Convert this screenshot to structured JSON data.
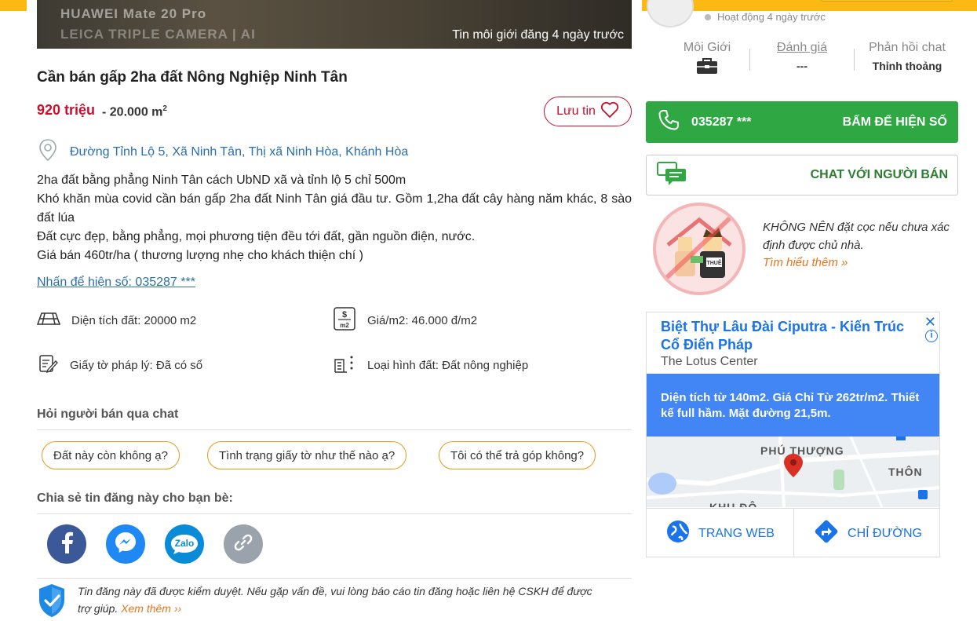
{
  "listing": {
    "photo_watermark_1": "HUAWEI Mate 20 Pro",
    "photo_watermark_2": "LEICA TRIPLE CAMERA | AI",
    "photo_caption": "Tin môi giới đăng 4 ngày trước",
    "title": "Cần bán gấp 2ha đất Nông Nghiệp Ninh Tân",
    "price": "920 triệu",
    "area_prefix": "- 20.000 m",
    "area_sup": "2",
    "save_label": "Lưu tin",
    "address": "Đường Tỉnh Lộ 5, Xã Ninh Tân, Thị xã Ninh Hòa, Khánh Hòa",
    "description": [
      "2ha đất bằng phẳng Ninh Tân cách UbND xã và tỉnh lộ 5 chỉ 500m",
      "Khó khăn mùa covid cần bán gấp 2ha đất Ninh Tân giá đầu tư. Gồm 1,2ha đất cây hàng năm khác, 8 sào đất lúa",
      "Đất cực đẹp, bằng phẳng, mọi phương tiện đều tới đất, gần nguồn điện, nước.",
      "Giá bán 460tr/ha ( thương lượng nhẹ cho khách thiện chí )"
    ],
    "show_phone_link": "Nhấn để hiện số: 035287 ***",
    "specs": {
      "area": "Diện tích đất: 20000 m2",
      "price_per_m2": "Giá/m2: 46.000 đ/m2",
      "legal": "Giấy tờ pháp lý: Đã có sổ",
      "land_type": "Loại hình đất: Đất nông nghiệp"
    }
  },
  "chat_section": {
    "title": "Hỏi người bán qua chat",
    "questions": [
      "Đất này còn không ạ?",
      "Tình trạng giấy tờ như thế nào ạ?",
      "Tôi có thể trả góp không?"
    ]
  },
  "share_section": {
    "title": "Chia sẻ tin đăng này cho bạn bè:",
    "zalo_label": "Zalo"
  },
  "notice": {
    "text": "Tin đăng này đã được kiểm duyệt. Nếu gặp vấn đề, vui lòng báo cáo tin đăng hoặc liên hệ CSKH để được trợ giúp.",
    "more": "Xem thêm ››"
  },
  "seller": {
    "activity": "Hoạt động 4 ngày trước",
    "stats": [
      {
        "label": "Môi Giới",
        "value": ""
      },
      {
        "label": "Đánh giá",
        "value": "---"
      },
      {
        "label": "Phản hồi chat",
        "value": "Thỉnh thoảng"
      }
    ],
    "phone": "035287 ***",
    "phone_cta": "BẤM ĐỂ HIỆN SỐ",
    "chat_cta": "CHAT VỚI NGƯỜI BÁN"
  },
  "warning": {
    "text": "KHÔNG NÊN đặt cọc nếu chưa xác định được chủ nhà.",
    "link": "Tìm hiểu thêm »",
    "sign_text": "THUÊ"
  },
  "ad": {
    "title": "Biệt Thự Lâu Đài Ciputra - Kiến Trúc Cổ Điển Pháp",
    "subtitle": "The Lotus Center",
    "body": "Diện tích từ 140m2. Giá Chỉ Từ 262tr/m2. Thiết kế full hầm. Mặt đường 21,5m.",
    "map_labels": [
      "PHÚ THƯỢNG",
      "THÔN",
      "KHU ĐÔ"
    ],
    "website_label": "TRANG WEB",
    "directions_label": "CHỈ ĐƯỜNG"
  },
  "colors": {
    "price_red": "#c8102e",
    "link_blue": "#2a6fb0",
    "accent_orange": "#e8731a",
    "phone_green": "#2fa844",
    "header_yellow": "#fdb913",
    "ad_blue": "#4285f4"
  }
}
